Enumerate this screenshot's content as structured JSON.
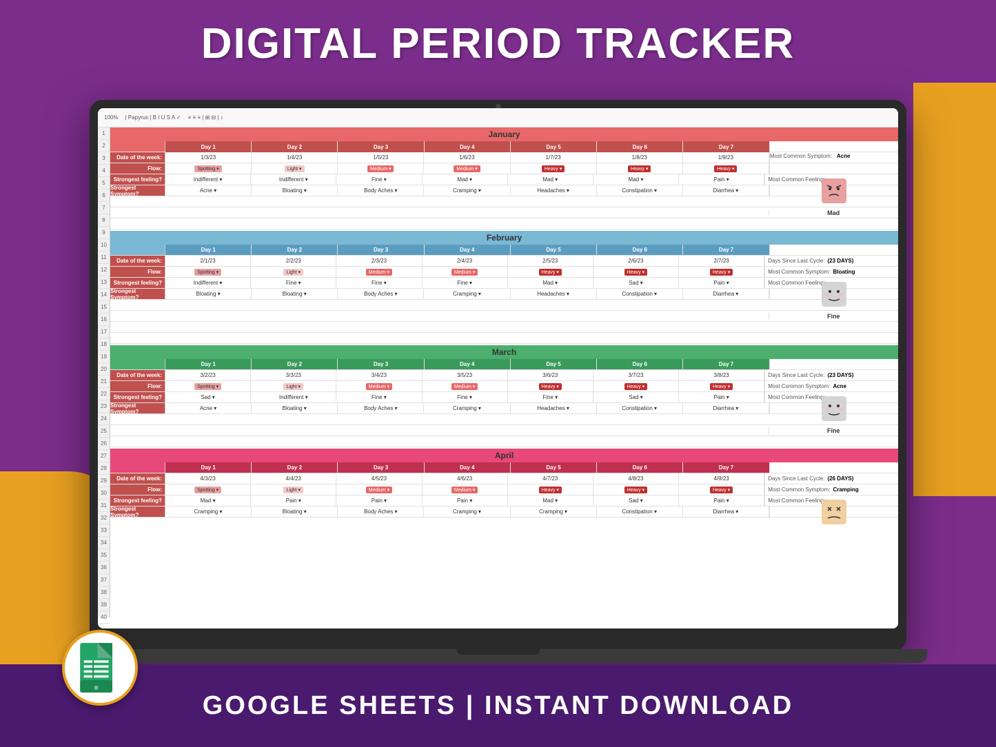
{
  "title": "DIGITAL PERIOD TRACKER",
  "subtitle": "GOOGLE SHEETS | INSTANT DOWNLOAD",
  "header": {
    "toolbar_text": "100%  |  Papyrus"
  },
  "months": [
    {
      "name": "January",
      "class": "january",
      "days": [
        "Day 1",
        "Day 2",
        "Day 3",
        "Day 4",
        "Day 5",
        "Day 6",
        "Day 7"
      ],
      "dates": [
        "1/3/23",
        "1/4/23",
        "1/5/23",
        "1/6/23",
        "1/7/23",
        "1/8/23",
        "1/9/23"
      ],
      "flow": [
        "Spotting",
        "Light",
        "Medium",
        "Medium",
        "Heavy",
        "Heavy",
        "Heavy"
      ],
      "feelings": [
        "Indifferent",
        "Indifferent",
        "Fine",
        "Mad",
        "Mad",
        "Mad",
        "Pain"
      ],
      "symptoms": [
        "Acne",
        "Bloating",
        "Body Aches",
        "Cramping",
        "Headaches",
        "Constipation",
        "Diarrhea"
      ],
      "stats": {
        "most_common_symptom_label": "Most Common Symptom:",
        "most_common_symptom": "Acne",
        "most_common_feeling_label": "Most Common Feeling:",
        "feeling": "Mad",
        "feeling_type": "mad"
      }
    },
    {
      "name": "February",
      "class": "february",
      "days": [
        "Day 1",
        "Day 2",
        "Day 3",
        "Day 4",
        "Day 5",
        "Day 6",
        "Day 7"
      ],
      "dates": [
        "2/1/23",
        "2/2/23",
        "2/3/23",
        "2/4/23",
        "2/5/23",
        "2/6/23",
        "2/7/23"
      ],
      "flow": [
        "Spotting",
        "Light",
        "Medium",
        "Medium",
        "Heavy",
        "Heavy",
        "Heavy"
      ],
      "feelings": [
        "Indifferent",
        "Fine",
        "Fine",
        "Fine",
        "Mad",
        "Sad",
        "Pain"
      ],
      "symptoms": [
        "Bloating",
        "Bloating",
        "Body Aches",
        "Cramping",
        "Headaches",
        "Constipation",
        "Diarrhea"
      ],
      "stats": {
        "days_since_label": "Days Since Last Cycle:",
        "days_since": "(23 DAYS)",
        "most_common_symptom_label": "Most Common Symptom:",
        "most_common_symptom": "Bloating",
        "most_common_feeling_label": "Most Common Feeling:",
        "feeling": "Fine",
        "feeling_type": "fine"
      }
    },
    {
      "name": "March",
      "class": "march",
      "days": [
        "Day 1",
        "Day 2",
        "Day 3",
        "Day 4",
        "Day 5",
        "Day 6",
        "Day 7"
      ],
      "dates": [
        "3/2/23",
        "3/3/23",
        "3/4/23",
        "3/5/23",
        "3/6/23",
        "3/7/23",
        "3/8/23"
      ],
      "flow": [
        "Spotting",
        "Light",
        "Medium",
        "Medium",
        "Heavy",
        "Heavy",
        "Heavy"
      ],
      "feelings": [
        "Sad",
        "Indifferent",
        "Fine",
        "Fine",
        "Fine",
        "Sad",
        "Pain"
      ],
      "symptoms": [
        "Acne",
        "Bloating",
        "Body Aches",
        "Cramping",
        "Headaches",
        "Constipation",
        "Diarrhea"
      ],
      "stats": {
        "days_since_label": "Days Since Last Cycle:",
        "days_since": "(23 DAYS)",
        "most_common_symptom_label": "Most Common Symptom:",
        "most_common_symptom": "Acne",
        "most_common_feeling_label": "Most Common Feeling:",
        "feeling": "Fine",
        "feeling_type": "fine"
      }
    },
    {
      "name": "April",
      "class": "april",
      "days": [
        "Day 1",
        "Day 2",
        "Day 3",
        "Day 4",
        "Day 5",
        "Day 6",
        "Day 7"
      ],
      "dates": [
        "4/3/23",
        "4/4/23",
        "4/5/23",
        "4/6/23",
        "4/7/23",
        "4/8/23",
        "4/9/23"
      ],
      "flow": [
        "Spotting",
        "Light",
        "Medium",
        "Medium",
        "Heavy",
        "Heavy",
        "Heavy"
      ],
      "feelings": [
        "Mad",
        "Pain",
        "Pain",
        "Pain",
        "Mad",
        "Sad",
        "Pain"
      ],
      "symptoms": [
        "Cramping",
        "Bloating",
        "Body Aches",
        "Cramping",
        "Cramping",
        "Constipation",
        "Diarrhea"
      ],
      "stats": {
        "days_since_label": "Days Since Last Cycle:",
        "days_since": "(26 DAYS)",
        "most_common_symptom_label": "Most Common Symptom:",
        "most_common_symptom": "Cramping",
        "most_common_feeling_label": "Most Common Feeling:",
        "feeling": "...",
        "feeling_type": "angry"
      }
    }
  ],
  "labels": {
    "date_of_week": "Date of the week:",
    "flow": "Flow:",
    "strongest_feeling": "Strongest feeling?",
    "strongest_symptom": "Strongest Symptom?"
  }
}
